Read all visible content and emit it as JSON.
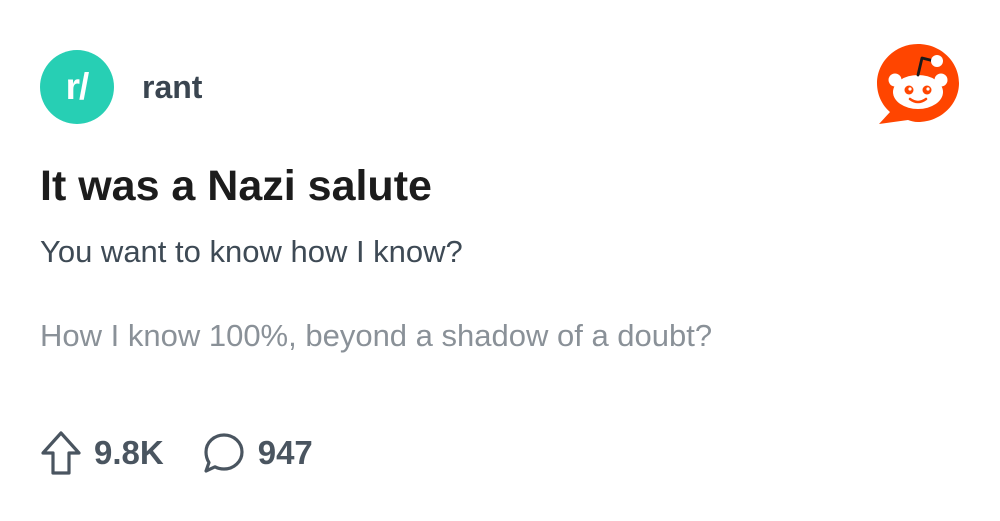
{
  "subreddit": {
    "icon_text": "r/",
    "name": "rant",
    "icon": "subreddit-icon",
    "accent_color": "#27cfb4"
  },
  "brand": {
    "icon": "reddit-logo-icon",
    "color": "#ff4500"
  },
  "post": {
    "title": "It was a Nazi salute",
    "body_line1": "You want to know how I know?",
    "body_line2": "How I know 100%, beyond a shadow of a doubt?"
  },
  "stats": {
    "upvotes": "9.8K",
    "upvote_icon": "upvote-arrow-icon",
    "comments": "947",
    "comment_icon": "comment-bubble-icon"
  }
}
